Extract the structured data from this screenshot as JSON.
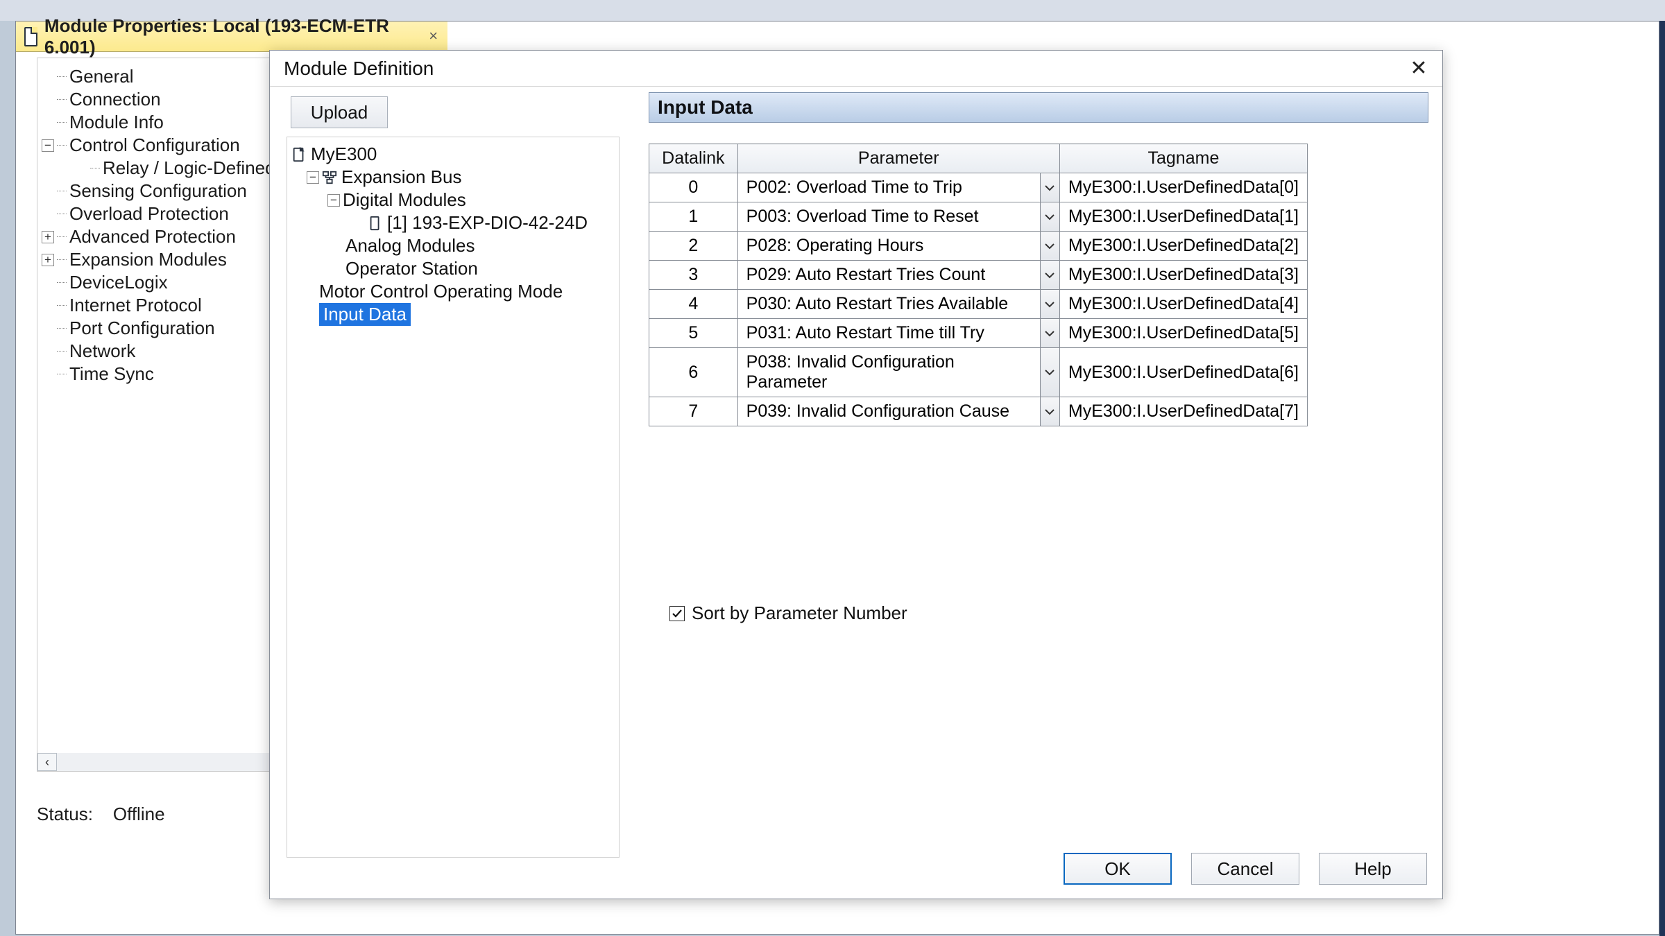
{
  "back_window": {
    "title": "Module Properties: Local (193-ECM-ETR 6.001)"
  },
  "left_tree": {
    "items": [
      {
        "label": "General",
        "indent": 1
      },
      {
        "label": "Connection",
        "indent": 1
      },
      {
        "label": "Module Info",
        "indent": 1
      },
      {
        "label": "Control Configuration",
        "indent": 1,
        "expander": "−"
      },
      {
        "label": "Relay / Logic-Defined",
        "indent": 2
      },
      {
        "label": "Sensing Configuration",
        "indent": 1
      },
      {
        "label": "Overload Protection",
        "indent": 1
      },
      {
        "label": "Advanced Protection",
        "indent": 1,
        "expander": "+"
      },
      {
        "label": "Expansion Modules",
        "indent": 1,
        "expander": "+"
      },
      {
        "label": "DeviceLogix",
        "indent": 1
      },
      {
        "label": "Internet Protocol",
        "indent": 1
      },
      {
        "label": "Port Configuration",
        "indent": 1
      },
      {
        "label": "Network",
        "indent": 1
      },
      {
        "label": "Time Sync",
        "indent": 1
      }
    ]
  },
  "status": {
    "label": "Status:",
    "value": "Offline"
  },
  "dialog": {
    "title": "Module Definition",
    "upload": "Upload",
    "tree": {
      "root": "MyE300",
      "expbus": "Expansion Bus",
      "digmod": "Digital Modules",
      "dig_child": "[1] 193-EXP-DIO-42-24D",
      "anamod": "Analog Modules",
      "opstation": "Operator Station",
      "mcom": "Motor Control Operating Mode",
      "inputdata": "Input Data"
    },
    "section_header": "Input Data",
    "columns": {
      "dl": "Datalink",
      "param": "Parameter",
      "tag": "Tagname"
    },
    "rows": [
      {
        "dl": "0",
        "param": "P002:  Overload Time to Trip",
        "tag": "MyE300:I.UserDefinedData[0]"
      },
      {
        "dl": "1",
        "param": "P003:  Overload Time to Reset",
        "tag": "MyE300:I.UserDefinedData[1]"
      },
      {
        "dl": "2",
        "param": "P028:  Operating Hours",
        "tag": "MyE300:I.UserDefinedData[2]"
      },
      {
        "dl": "3",
        "param": "P029:  Auto Restart Tries Count",
        "tag": "MyE300:I.UserDefinedData[3]"
      },
      {
        "dl": "4",
        "param": "P030:  Auto Restart Tries Available",
        "tag": "MyE300:I.UserDefinedData[4]"
      },
      {
        "dl": "5",
        "param": "P031:  Auto Restart Time till Try",
        "tag": "MyE300:I.UserDefinedData[5]"
      },
      {
        "dl": "6",
        "param": "P038:  Invalid Configuration Parameter",
        "tag": "MyE300:I.UserDefinedData[6]"
      },
      {
        "dl": "7",
        "param": "P039:  Invalid Configuration Cause",
        "tag": "MyE300:I.UserDefinedData[7]"
      }
    ],
    "sort_label": "Sort by Parameter Number",
    "sort_checked": true,
    "buttons": {
      "ok": "OK",
      "cancel": "Cancel",
      "help": "Help"
    }
  }
}
